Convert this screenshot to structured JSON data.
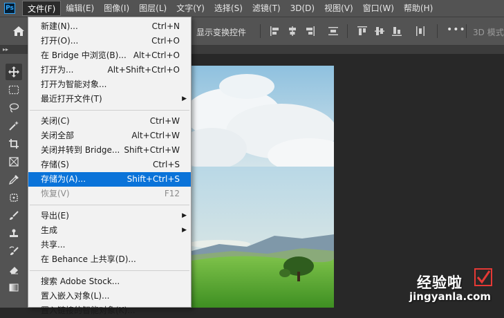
{
  "menubar": {
    "logo": "Ps",
    "items": [
      "文件(F)",
      "编辑(E)",
      "图像(I)",
      "图层(L)",
      "文字(Y)",
      "选择(S)",
      "滤镜(T)",
      "3D(D)",
      "视图(V)",
      "窗口(W)",
      "帮助(H)"
    ],
    "active_index": 0
  },
  "optbar": {
    "show_transform_label": "显示变换控件",
    "more_label": "•••",
    "mode_3d_label": "3D 模式："
  },
  "file_menu": {
    "group1": [
      {
        "label": "新建(N)...",
        "shortcut": "Ctrl+N"
      },
      {
        "label": "打开(O)...",
        "shortcut": "Ctrl+O"
      },
      {
        "label": "在 Bridge 中浏览(B)...",
        "shortcut": "Alt+Ctrl+O"
      },
      {
        "label": "打开为...",
        "shortcut": "Alt+Shift+Ctrl+O"
      },
      {
        "label": "打开为智能对象...",
        "shortcut": ""
      },
      {
        "label": "最近打开文件(T)",
        "shortcut": "",
        "submenu": true
      }
    ],
    "group2": [
      {
        "label": "关闭(C)",
        "shortcut": "Ctrl+W"
      },
      {
        "label": "关闭全部",
        "shortcut": "Alt+Ctrl+W"
      },
      {
        "label": "关闭并转到 Bridge...",
        "shortcut": "Shift+Ctrl+W"
      },
      {
        "label": "存储(S)",
        "shortcut": "Ctrl+S"
      },
      {
        "label": "存储为(A)...",
        "shortcut": "Shift+Ctrl+S",
        "highlighted": true
      },
      {
        "label": "恢复(V)",
        "shortcut": "F12",
        "disabled": true
      }
    ],
    "group3": [
      {
        "label": "导出(E)",
        "shortcut": "",
        "submenu": true
      },
      {
        "label": "生成",
        "shortcut": "",
        "submenu": true
      },
      {
        "label": "共享...",
        "shortcut": ""
      },
      {
        "label": "在 Behance 上共享(D)...",
        "shortcut": ""
      }
    ],
    "group4": [
      {
        "label": "搜索 Adobe Stock...",
        "shortcut": ""
      },
      {
        "label": "置入嵌入对象(L)...",
        "shortcut": ""
      },
      {
        "label": "置入链接的智能对象(K)...",
        "shortcut": ""
      }
    ]
  },
  "watermark": {
    "text": "经验啦",
    "url": "jingyanla.com"
  },
  "colors": {
    "menu_highlight": "#0a73d9",
    "chrome": "#535353",
    "workspace": "#282828"
  }
}
